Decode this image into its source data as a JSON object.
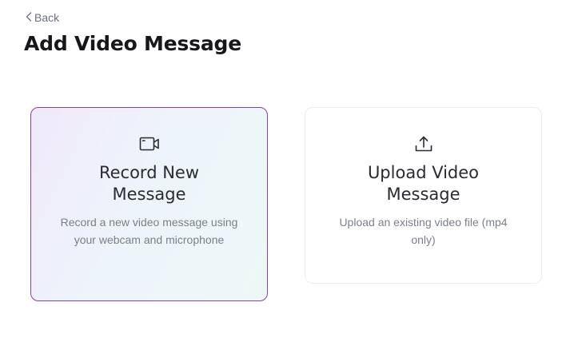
{
  "nav": {
    "back_label": "Back"
  },
  "header": {
    "title": "Add Video Message"
  },
  "options": [
    {
      "icon": "video-camera-icon",
      "title": "Record New Message",
      "description": "Record a new video message using your webcam and microphone",
      "selected": true
    },
    {
      "icon": "upload-icon",
      "title": "Upload Video Message",
      "description": "Upload an existing video file (mp4 only)",
      "selected": false
    }
  ],
  "colors": {
    "selected_border": "#8e3fae",
    "card_border": "#ececf0",
    "title_text": "#16161d",
    "muted_text": "#7b7f8c"
  }
}
